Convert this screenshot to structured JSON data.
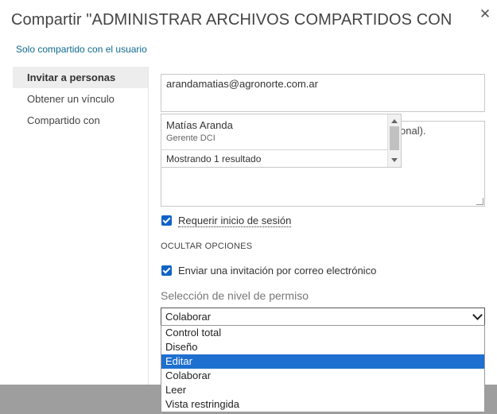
{
  "dialog": {
    "title": "Compartir \"ADMINISTRAR ARCHIVOS COMPARTIDOS CON ONED...",
    "close_icon": "close-icon",
    "subtitle": "Solo compartido con el usuario"
  },
  "nav": {
    "items": [
      {
        "label": "Invitar a personas",
        "active": true
      },
      {
        "label": "Obtener un vínculo",
        "active": false
      },
      {
        "label": "Compartido con",
        "active": false
      }
    ]
  },
  "invite": {
    "email": "arandamatias@agronorte.com.ar",
    "message_placeholder_tail": "onal).",
    "suggestion": {
      "name": "Matías Aranda",
      "role": "Gerente DCI",
      "count_text": "Mostrando 1 resultado"
    },
    "require_signin": {
      "label": "Requerir inicio de sesión",
      "checked": true
    },
    "options_header": "OCULTAR OPCIONES",
    "send_email": {
      "label": "Enviar una invitación por correo electrónico",
      "checked": true
    },
    "permission": {
      "label": "Selección de nivel de permiso",
      "selected_value": "Colaborar",
      "options": [
        "Control total",
        "Diseño",
        "Editar",
        "Colaborar",
        "Leer",
        "Vista restringida"
      ],
      "highlighted": "Editar"
    }
  },
  "colors": {
    "accent": "#0f62c6",
    "link": "#0f6a8f",
    "highlight": "#1e6fd0"
  }
}
